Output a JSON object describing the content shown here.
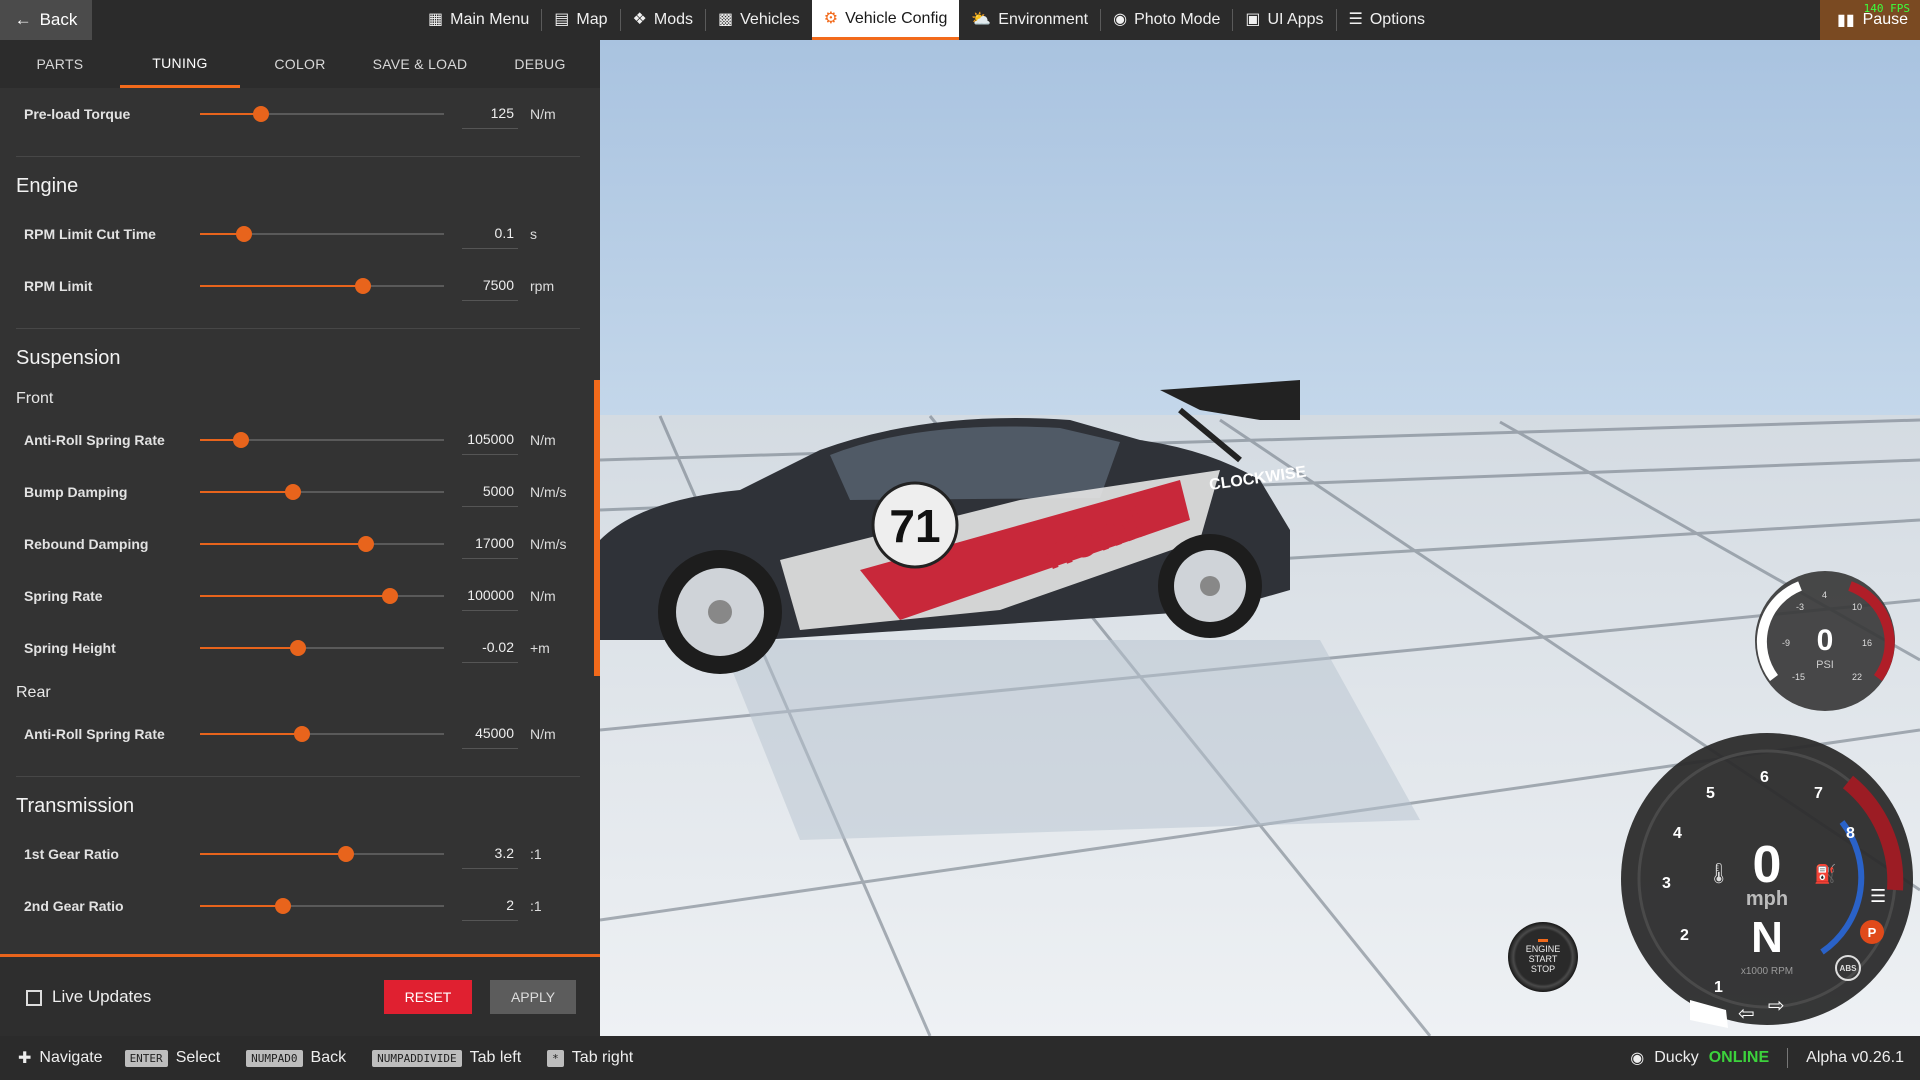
{
  "topbar": {
    "back_label": "Back",
    "nav": [
      {
        "label": "Main Menu",
        "icon": "grid-icon"
      },
      {
        "label": "Map",
        "icon": "map-icon"
      },
      {
        "label": "Mods",
        "icon": "puzzle-icon"
      },
      {
        "label": "Vehicles",
        "icon": "car-icon"
      },
      {
        "label": "Vehicle Config",
        "icon": "engine-icon",
        "active": true
      },
      {
        "label": "Environment",
        "icon": "weather-icon"
      },
      {
        "label": "Photo Mode",
        "icon": "camera-icon"
      },
      {
        "label": "UI Apps",
        "icon": "apps-icon"
      },
      {
        "label": "Options",
        "icon": "sliders-icon"
      }
    ],
    "pause_label": "Pause",
    "fps": "140 FPS",
    "accent": "#f26a1b"
  },
  "panel": {
    "tabs": [
      "PARTS",
      "TUNING",
      "COLOR",
      "SAVE & LOAD",
      "DEBUG"
    ],
    "active_tab": "TUNING",
    "top_row": {
      "label": "Pre-load Torque",
      "value": "125",
      "unit": "N/m",
      "fraction": 0.25
    },
    "engine": {
      "title": "Engine",
      "rows": [
        {
          "label": "RPM Limit Cut Time",
          "value": "0.1",
          "unit": "s",
          "fraction": 0.18
        },
        {
          "label": "RPM Limit",
          "value": "7500",
          "unit": "rpm",
          "fraction": 0.67
        }
      ]
    },
    "suspension": {
      "title": "Suspension",
      "front_title": "Front",
      "front_rows": [
        {
          "label": "Anti-Roll Spring Rate",
          "value": "105000",
          "unit": "N/m",
          "fraction": 0.17
        },
        {
          "label": "Bump Damping",
          "value": "5000",
          "unit": "N/m/s",
          "fraction": 0.38
        },
        {
          "label": "Rebound Damping",
          "value": "17000",
          "unit": "N/m/s",
          "fraction": 0.68
        },
        {
          "label": "Spring Rate",
          "value": "100000",
          "unit": "N/m",
          "fraction": 0.78
        },
        {
          "label": "Spring Height",
          "value": "-0.02",
          "unit": "+m",
          "fraction": 0.4
        }
      ],
      "rear_title": "Rear",
      "rear_rows": [
        {
          "label": "Anti-Roll Spring Rate",
          "value": "45000",
          "unit": "N/m",
          "fraction": 0.42
        }
      ]
    },
    "transmission": {
      "title": "Transmission",
      "rows": [
        {
          "label": "1st Gear Ratio",
          "value": "3.2",
          "unit": ":1",
          "fraction": 0.6
        },
        {
          "label": "2nd Gear Ratio",
          "value": "2",
          "unit": ":1",
          "fraction": 0.34
        }
      ]
    },
    "footer": {
      "live_updates_label": "Live Updates",
      "live_updates_checked": false,
      "reset_label": "RESET",
      "apply_label": "APPLY"
    }
  },
  "viewport": {
    "car_number": "71",
    "brand_text": "nomi",
    "sponsor_text": "CLOCKWISE"
  },
  "gauges": {
    "boost": {
      "value": "0",
      "unit": "PSI",
      "ticks": [
        "-3",
        "4",
        "10",
        "-9",
        "16",
        "-15",
        "22"
      ]
    },
    "speed": {
      "value": "0",
      "unit": "mph",
      "gear": "N",
      "rpm_unit": "x1000 RPM",
      "rpm_ticks": [
        "1",
        "2",
        "3",
        "4",
        "5",
        "6",
        "7",
        "8"
      ]
    },
    "engine_button": {
      "line1": "ENGINE",
      "line2": "START",
      "line3": "STOP"
    },
    "indicators": {
      "parking": "P",
      "abs": "ABS"
    }
  },
  "bottombar": {
    "hints": [
      {
        "key": "",
        "icon": "dpad-icon",
        "label": "Navigate"
      },
      {
        "key": "ENTER",
        "label": "Select"
      },
      {
        "key": "NUMPAD0",
        "label": "Back"
      },
      {
        "key": "NUMPADDIVIDE",
        "label": "Tab left"
      },
      {
        "key": "*",
        "label": "Tab right"
      }
    ],
    "user": "Ducky",
    "status": "ONLINE",
    "version": "Alpha v0.26.1"
  }
}
